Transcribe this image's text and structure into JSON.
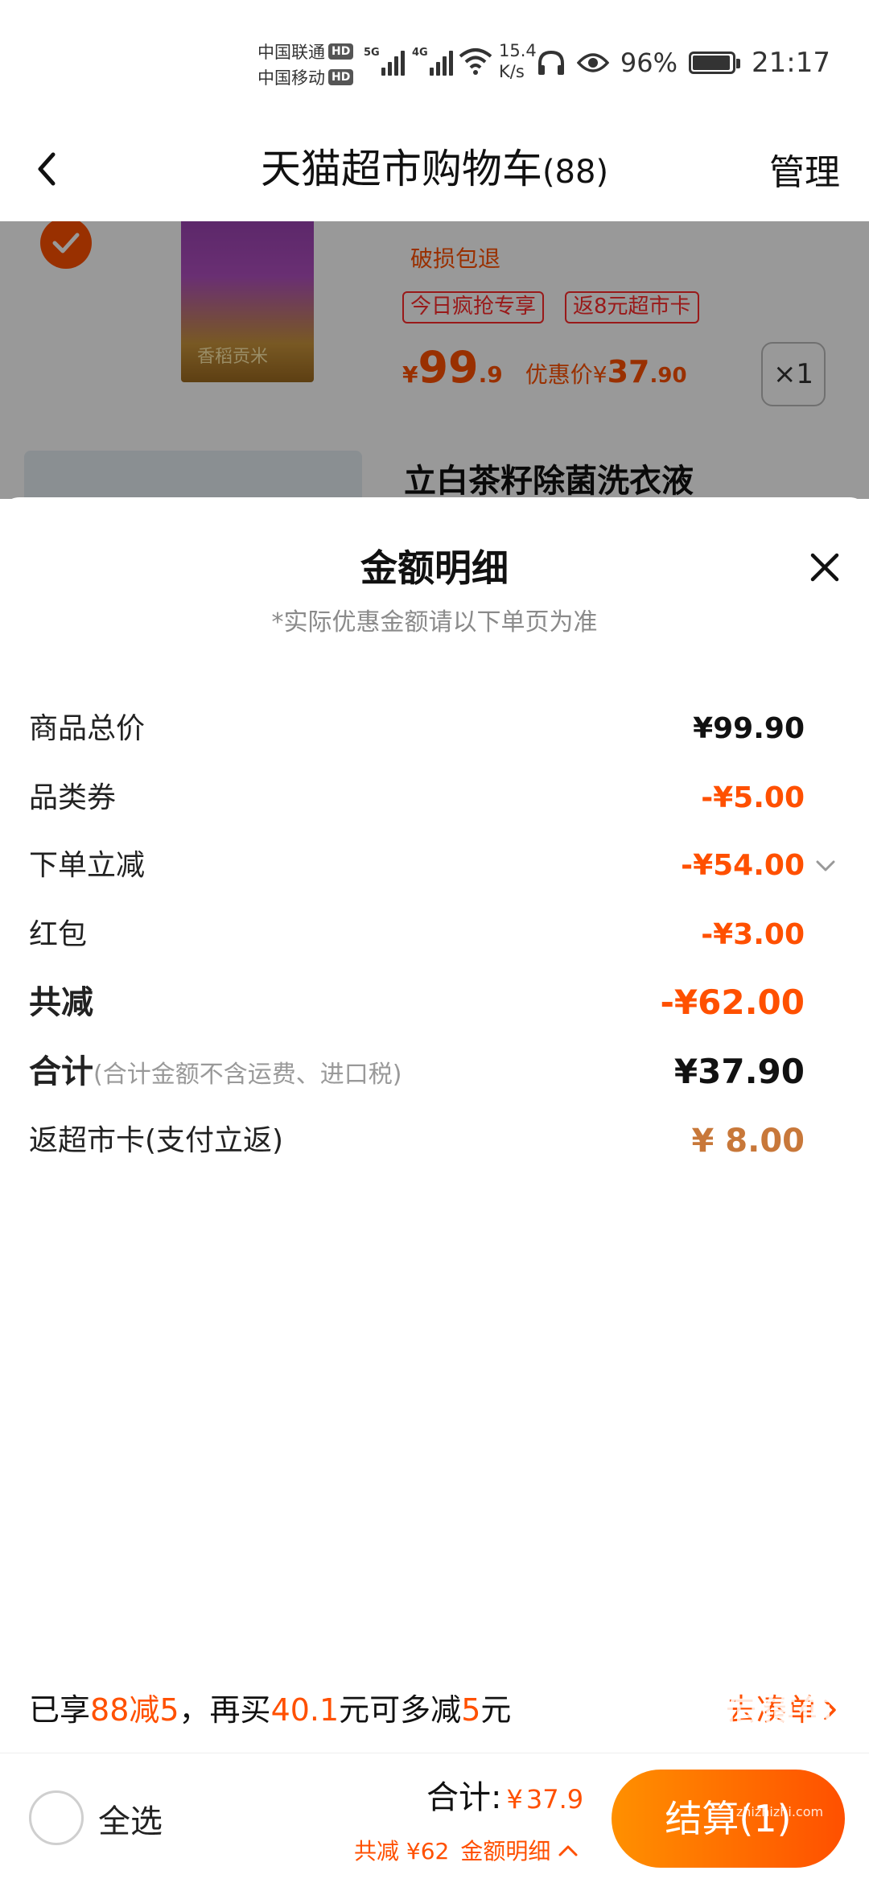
{
  "status_bar": {
    "carrier1": "中国联通",
    "carrier2": "中国移动",
    "hd_badge": "HD",
    "net1": "5G",
    "net2": "4G",
    "speed_value": "15.4",
    "speed_unit": "K/s",
    "battery_pct": "96%",
    "time": "21:17"
  },
  "nav": {
    "title": "天猫超市购物车",
    "count": "(88)",
    "manage": "管理"
  },
  "cart": {
    "product_stamp": "香稻贡米",
    "damage_tag": "破损包退",
    "promo_tags": [
      "今日疯抢专享",
      "返8元超市卡"
    ],
    "price_yen": "¥",
    "price_int": "99",
    "price_dec": ".9",
    "discount_label": "优惠价¥",
    "discount_int": "37",
    "discount_dec": ".90",
    "qty": "×1",
    "product2_title": "立白茶籽除菌洗衣液"
  },
  "sheet": {
    "title": "金额明细",
    "subtitle": "*实际优惠金额请以下单页为准",
    "rows": [
      {
        "label": "商品总价",
        "value": "¥99.90"
      },
      {
        "label": "品类券",
        "value": "-¥5.00"
      },
      {
        "label": "下单立减",
        "value": "-¥54.00"
      },
      {
        "label": "红包",
        "value": "-¥3.00"
      },
      {
        "label": "共减",
        "value": "-¥62.00"
      },
      {
        "label": "合计",
        "note": "(合计金额不含运费、进口税)",
        "value": "¥37.90"
      },
      {
        "label": "返超市卡(支付立返)",
        "value": "¥ 8.00"
      }
    ]
  },
  "bonus": {
    "p1": "已享",
    "p2": "88减5",
    "p3": "，再买",
    "p4": "40.1",
    "p5": "元可多减",
    "p6": "5",
    "p7": "元",
    "go_label": "去凑单"
  },
  "bottom_bar": {
    "select_all": "全选",
    "total_label": "合计:",
    "total_yen": "¥",
    "total_value": "37.9",
    "saved_label": "共减",
    "saved_value": "¥62",
    "detail_label": "金额明细",
    "checkout_label": "结算(1)",
    "watermark_main": "值值值",
    "watermark_sub": "zhizhizhi.com"
  },
  "colors": {
    "accent": "#ff5000",
    "card_brown": "#c8783a",
    "button_gradient_start": "#ff9000"
  }
}
